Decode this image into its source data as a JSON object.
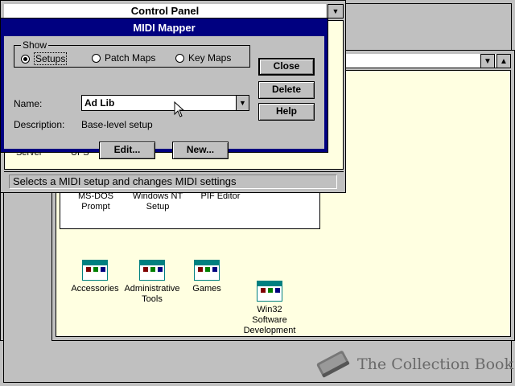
{
  "control_panel": {
    "title": "Control Panel",
    "status_text": "Selects a MIDI setup and changes MIDI settings",
    "partial_labels": [
      "Server",
      "UPS"
    ]
  },
  "midi_mapper": {
    "title": "MIDI Mapper",
    "show_group_title": "Show",
    "radio_setups": "Setups",
    "radio_patch_maps": "Patch Maps",
    "radio_key_maps": "Key Maps",
    "selected_radio": "Setups",
    "name_label": "Name:",
    "name_value": "Ad Lib",
    "description_label": "Description:",
    "description_value": "Base-level setup",
    "buttons": {
      "close": "Close",
      "delete": "Delete",
      "help": "Help",
      "edit": "Edit...",
      "new": "New..."
    }
  },
  "main_group": {
    "items": [
      "MS-DOS\nPrompt",
      "Windows NT\nSetup",
      "PIF Editor"
    ]
  },
  "program_manager_groups": [
    {
      "label": "Accessories"
    },
    {
      "label": "Administrative\nTools"
    },
    {
      "label": "Games"
    },
    {
      "label": "Win32\nSoftware\nDevelopment"
    }
  ],
  "watermark": {
    "text": "The Collection Book",
    "icon": "book-icon"
  },
  "colors": {
    "desktop": "#c0c0c0",
    "client": "#ffffe1",
    "active_title": "#000080",
    "window_bg": "#c0c0c0"
  }
}
